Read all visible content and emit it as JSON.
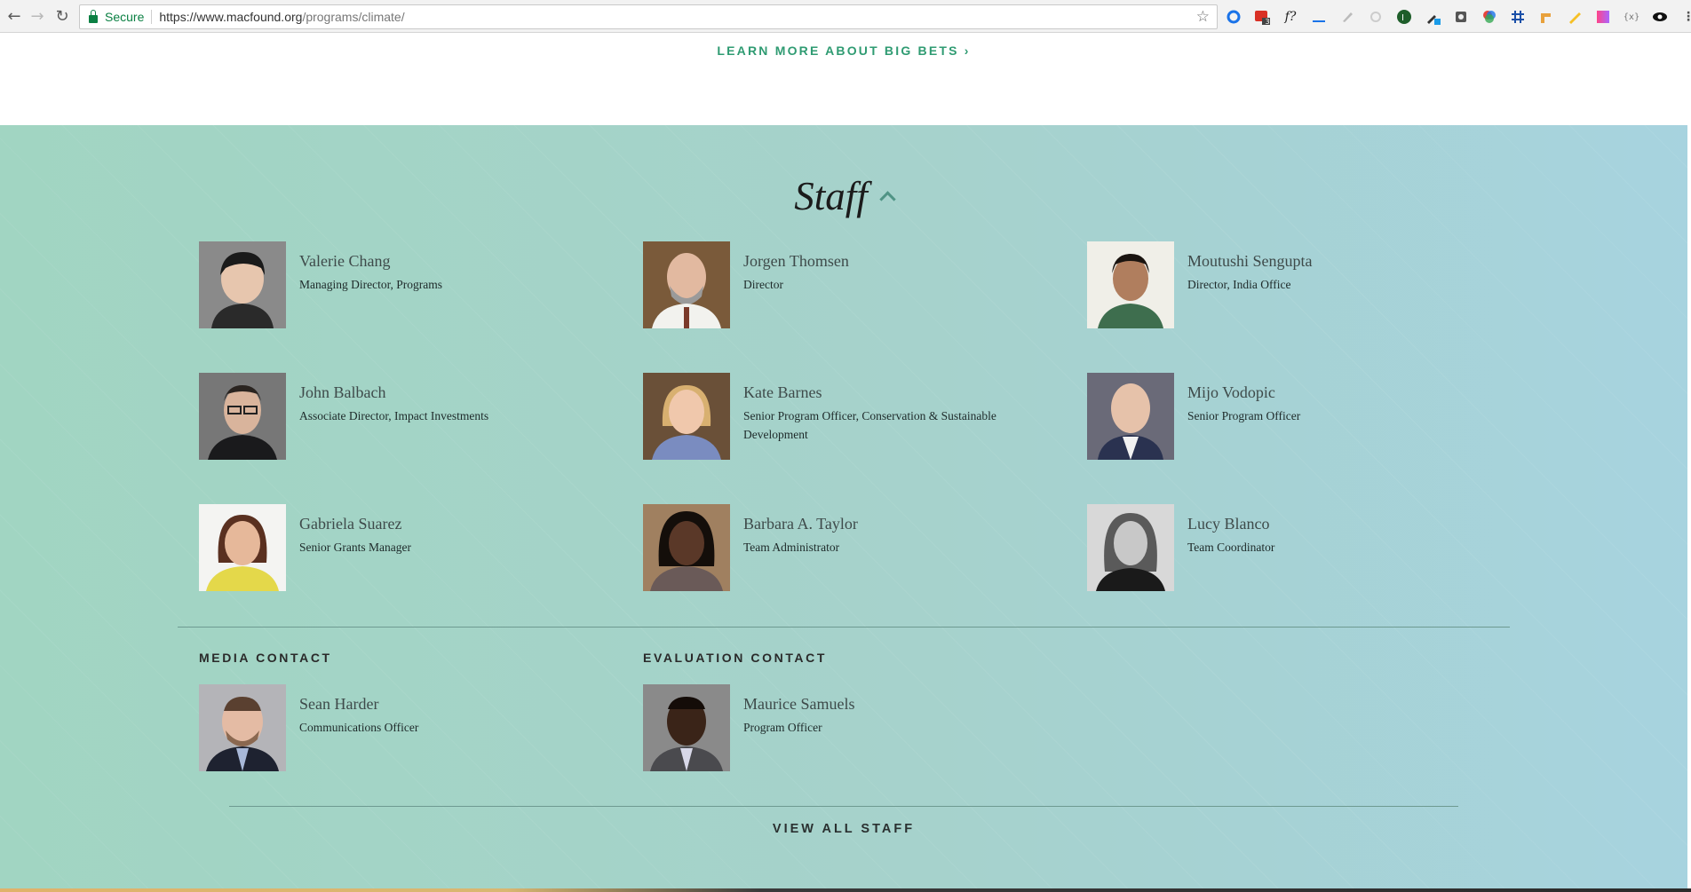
{
  "browser": {
    "secure_label": "Secure",
    "url_host": "https://www.macfound.org",
    "url_path": "/programs/climate/",
    "ext_badge": "3"
  },
  "top": {
    "big_bets_link": "LEARN MORE ABOUT BIG BETS ›"
  },
  "staff_section": {
    "title": "Staff",
    "members": [
      {
        "name": "Valerie Chang",
        "title": "Managing Director, Programs",
        "tone": "#4a4a4a"
      },
      {
        "name": "Jorgen Thomsen",
        "title": "Director",
        "tone": "#8a6a4a"
      },
      {
        "name": "Moutushi Sengupta",
        "title": "Director, India Office",
        "tone": "#6e5a48"
      },
      {
        "name": "John Balbach",
        "title": "Associate Director, Impact Investments",
        "tone": "#3e3e40"
      },
      {
        "name": "Kate Barnes",
        "title": "Senior Program Officer, Conservation & Sustainable Development",
        "tone": "#8a7050"
      },
      {
        "name": "Mijo Vodopic",
        "title": "Senior Program Officer",
        "tone": "#6a6a7a"
      },
      {
        "name": "Gabriela Suarez",
        "title": "Senior Grants Manager",
        "tone": "#d6cc88"
      },
      {
        "name": "Barbara A. Taylor",
        "title": "Team Administrator",
        "tone": "#5a4030"
      },
      {
        "name": "Lucy Blanco",
        "title": "Team Coordinator",
        "tone": "#7a7a7a"
      }
    ],
    "media_contact": {
      "heading": "MEDIA CONTACT",
      "name": "Sean Harder",
      "title": "Communications Officer",
      "tone": "#9a9a9c"
    },
    "evaluation_contact": {
      "heading": "EVALUATION CONTACT",
      "name": "Maurice Samuels",
      "title": "Program Officer",
      "tone": "#6a6a6a"
    },
    "view_all": "VIEW ALL STAFF"
  },
  "colors": {
    "accent_link": "#2f9b72",
    "section_bg_start": "#a1d5c2",
    "section_bg_end": "#a7d3df"
  }
}
